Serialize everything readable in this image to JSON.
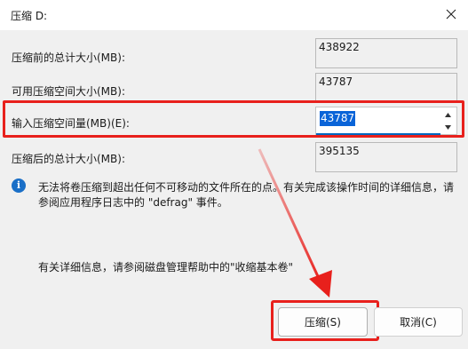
{
  "window": {
    "title": "压缩 D:",
    "close_icon": "close-icon"
  },
  "fields": {
    "total_before_label": "压缩前的总计大小(MB):",
    "total_before_value": "438922",
    "available_label": "可用压缩空间大小(MB):",
    "available_value": "43787",
    "input_label": "输入压缩空间量(MB)(E):",
    "input_value": "43787",
    "total_after_label": "压缩后的总计大小(MB):",
    "total_after_value": "395135"
  },
  "info": {
    "icon": "info-icon",
    "line1": "无法将卷压缩到超出任何不可移动的文件所在的点。有关完成该操作时间的详细信息，请",
    "line2": "参阅应用程序日志中的 \"defrag\" 事件。",
    "help_text": "有关详细信息，请参阅磁盘管理帮助中的\"收缩基本卷\""
  },
  "buttons": {
    "shrink_label": "压缩(S)",
    "cancel_label": "取消(C)"
  },
  "annotation": {
    "highlight_color": "#e8201c",
    "accent_color": "#0067c0"
  }
}
